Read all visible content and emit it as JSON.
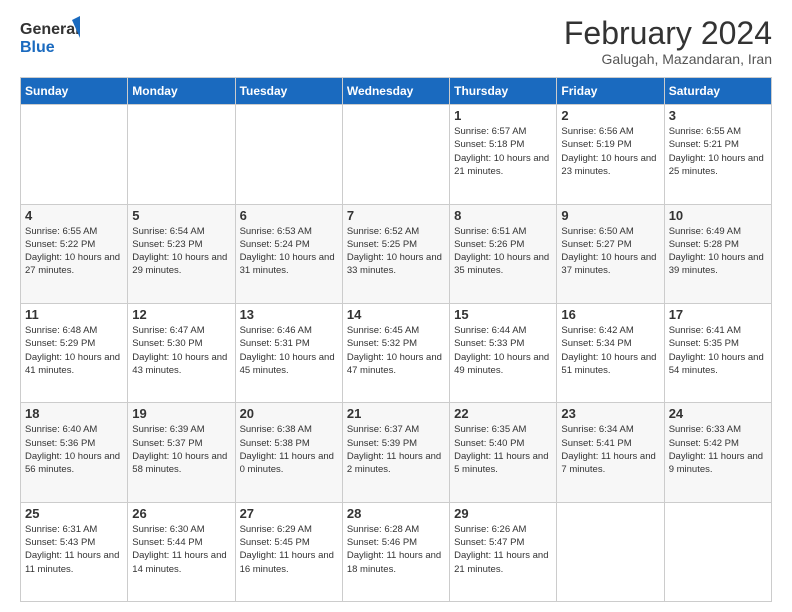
{
  "logo": {
    "general": "General",
    "blue": "Blue"
  },
  "title": "February 2024",
  "subtitle": "Galugah, Mazandaran, Iran",
  "days_of_week": [
    "Sunday",
    "Monday",
    "Tuesday",
    "Wednesday",
    "Thursday",
    "Friday",
    "Saturday"
  ],
  "weeks": [
    [
      {
        "day": "",
        "info": ""
      },
      {
        "day": "",
        "info": ""
      },
      {
        "day": "",
        "info": ""
      },
      {
        "day": "",
        "info": ""
      },
      {
        "day": "1",
        "info": "Sunrise: 6:57 AM\nSunset: 5:18 PM\nDaylight: 10 hours and 21 minutes."
      },
      {
        "day": "2",
        "info": "Sunrise: 6:56 AM\nSunset: 5:19 PM\nDaylight: 10 hours and 23 minutes."
      },
      {
        "day": "3",
        "info": "Sunrise: 6:55 AM\nSunset: 5:21 PM\nDaylight: 10 hours and 25 minutes."
      }
    ],
    [
      {
        "day": "4",
        "info": "Sunrise: 6:55 AM\nSunset: 5:22 PM\nDaylight: 10 hours and 27 minutes."
      },
      {
        "day": "5",
        "info": "Sunrise: 6:54 AM\nSunset: 5:23 PM\nDaylight: 10 hours and 29 minutes."
      },
      {
        "day": "6",
        "info": "Sunrise: 6:53 AM\nSunset: 5:24 PM\nDaylight: 10 hours and 31 minutes."
      },
      {
        "day": "7",
        "info": "Sunrise: 6:52 AM\nSunset: 5:25 PM\nDaylight: 10 hours and 33 minutes."
      },
      {
        "day": "8",
        "info": "Sunrise: 6:51 AM\nSunset: 5:26 PM\nDaylight: 10 hours and 35 minutes."
      },
      {
        "day": "9",
        "info": "Sunrise: 6:50 AM\nSunset: 5:27 PM\nDaylight: 10 hours and 37 minutes."
      },
      {
        "day": "10",
        "info": "Sunrise: 6:49 AM\nSunset: 5:28 PM\nDaylight: 10 hours and 39 minutes."
      }
    ],
    [
      {
        "day": "11",
        "info": "Sunrise: 6:48 AM\nSunset: 5:29 PM\nDaylight: 10 hours and 41 minutes."
      },
      {
        "day": "12",
        "info": "Sunrise: 6:47 AM\nSunset: 5:30 PM\nDaylight: 10 hours and 43 minutes."
      },
      {
        "day": "13",
        "info": "Sunrise: 6:46 AM\nSunset: 5:31 PM\nDaylight: 10 hours and 45 minutes."
      },
      {
        "day": "14",
        "info": "Sunrise: 6:45 AM\nSunset: 5:32 PM\nDaylight: 10 hours and 47 minutes."
      },
      {
        "day": "15",
        "info": "Sunrise: 6:44 AM\nSunset: 5:33 PM\nDaylight: 10 hours and 49 minutes."
      },
      {
        "day": "16",
        "info": "Sunrise: 6:42 AM\nSunset: 5:34 PM\nDaylight: 10 hours and 51 minutes."
      },
      {
        "day": "17",
        "info": "Sunrise: 6:41 AM\nSunset: 5:35 PM\nDaylight: 10 hours and 54 minutes."
      }
    ],
    [
      {
        "day": "18",
        "info": "Sunrise: 6:40 AM\nSunset: 5:36 PM\nDaylight: 10 hours and 56 minutes."
      },
      {
        "day": "19",
        "info": "Sunrise: 6:39 AM\nSunset: 5:37 PM\nDaylight: 10 hours and 58 minutes."
      },
      {
        "day": "20",
        "info": "Sunrise: 6:38 AM\nSunset: 5:38 PM\nDaylight: 11 hours and 0 minutes."
      },
      {
        "day": "21",
        "info": "Sunrise: 6:37 AM\nSunset: 5:39 PM\nDaylight: 11 hours and 2 minutes."
      },
      {
        "day": "22",
        "info": "Sunrise: 6:35 AM\nSunset: 5:40 PM\nDaylight: 11 hours and 5 minutes."
      },
      {
        "day": "23",
        "info": "Sunrise: 6:34 AM\nSunset: 5:41 PM\nDaylight: 11 hours and 7 minutes."
      },
      {
        "day": "24",
        "info": "Sunrise: 6:33 AM\nSunset: 5:42 PM\nDaylight: 11 hours and 9 minutes."
      }
    ],
    [
      {
        "day": "25",
        "info": "Sunrise: 6:31 AM\nSunset: 5:43 PM\nDaylight: 11 hours and 11 minutes."
      },
      {
        "day": "26",
        "info": "Sunrise: 6:30 AM\nSunset: 5:44 PM\nDaylight: 11 hours and 14 minutes."
      },
      {
        "day": "27",
        "info": "Sunrise: 6:29 AM\nSunset: 5:45 PM\nDaylight: 11 hours and 16 minutes."
      },
      {
        "day": "28",
        "info": "Sunrise: 6:28 AM\nSunset: 5:46 PM\nDaylight: 11 hours and 18 minutes."
      },
      {
        "day": "29",
        "info": "Sunrise: 6:26 AM\nSunset: 5:47 PM\nDaylight: 11 hours and 21 minutes."
      },
      {
        "day": "",
        "info": ""
      },
      {
        "day": "",
        "info": ""
      }
    ]
  ]
}
